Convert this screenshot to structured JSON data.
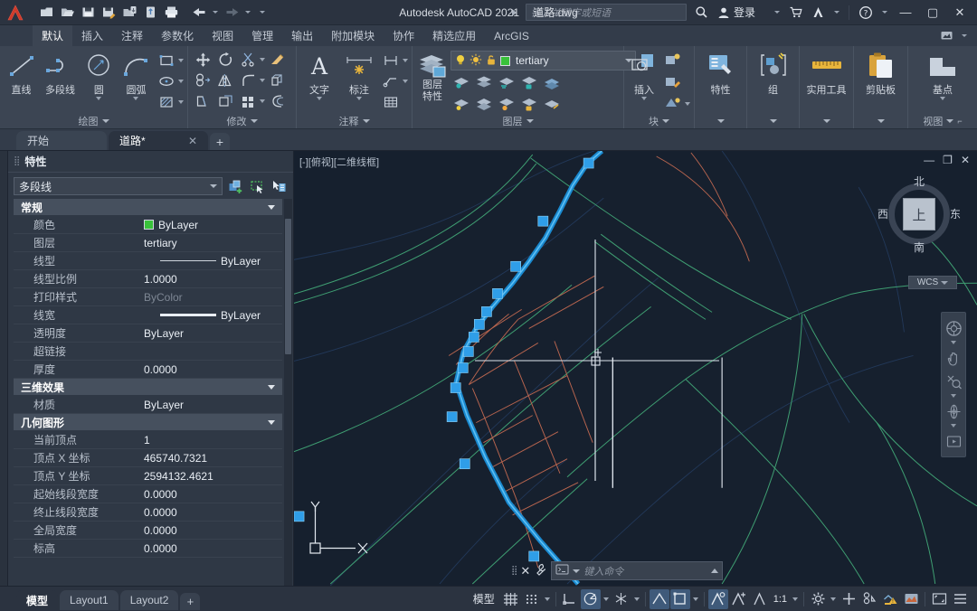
{
  "titlebar": {
    "app_title": "Autodesk AutoCAD 2021",
    "file_name": "道路.dwg",
    "search_placeholder": "键入关键字或短语",
    "signin_label": "登录",
    "qat": [
      {
        "name": "new-file",
        "label": "新建"
      },
      {
        "name": "open-file",
        "label": "打开"
      },
      {
        "name": "save-file",
        "label": "保存"
      },
      {
        "name": "save-as",
        "label": "另存为"
      },
      {
        "name": "open-from-web",
        "label": "从 Web 打开"
      },
      {
        "name": "save-to-web",
        "label": "保存到 Web"
      },
      {
        "name": "plot",
        "label": "打印"
      },
      {
        "name": "undo",
        "label": "放弃"
      },
      {
        "name": "redo",
        "label": "重做"
      }
    ],
    "window_buttons": {
      "minimize": "—",
      "maximize": "▢",
      "close": "✕"
    }
  },
  "ribbon_tabs": [
    {
      "label": "默认",
      "active": true
    },
    {
      "label": "插入",
      "active": false
    },
    {
      "label": "注释",
      "active": false
    },
    {
      "label": "参数化",
      "active": false
    },
    {
      "label": "视图",
      "active": false
    },
    {
      "label": "管理",
      "active": false
    },
    {
      "label": "输出",
      "active": false
    },
    {
      "label": "附加模块",
      "active": false
    },
    {
      "label": "协作",
      "active": false
    },
    {
      "label": "精选应用",
      "active": false
    },
    {
      "label": "ArcGIS",
      "active": false
    }
  ],
  "ribbon_panels": {
    "draw": {
      "title": "绘图",
      "buttons": [
        {
          "label": "直线",
          "icon": "line-icon"
        },
        {
          "label": "多段线",
          "icon": "polyline-icon"
        },
        {
          "label": "圆",
          "icon": "circle-icon"
        },
        {
          "label": "圆弧",
          "icon": "arc-icon"
        }
      ],
      "small": [
        "rectangle-icon",
        "ellipse-icon",
        "hatch-icon"
      ]
    },
    "modify": {
      "title": "修改",
      "small": [
        "move-icon",
        "rotate-icon",
        "trim-icon",
        "erase-icon",
        "copy-icon",
        "mirror-icon",
        "fillet-icon",
        "explode-icon",
        "stretch-icon",
        "scale-icon",
        "array-icon",
        "offset-icon"
      ]
    },
    "annotation": {
      "title": "注释",
      "buttons": [
        {
          "label": "文字",
          "icon": "text-icon"
        },
        {
          "label": "标注",
          "icon": "dimension-icon"
        }
      ],
      "small": [
        "dimension-style-icon",
        "leader-icon",
        "table-icon"
      ]
    },
    "layers": {
      "title": "图层",
      "properties_label_line1": "图层",
      "properties_label_line2": "特性",
      "current_layer": "tertiary",
      "layer_color": "#39c13a",
      "state_icons": [
        "lightbulb-on-icon",
        "sun-icon",
        "unlock-icon"
      ],
      "small": [
        "layer-isolate-icon",
        "layer-freeze-icon",
        "layer-off-icon",
        "layer-lock-icon",
        "layer-merge-icon",
        "layer-unisolate-icon",
        "layer-match-icon",
        "layer-thaw-icon",
        "layer-unlock-icon",
        "layer-change-icon"
      ]
    },
    "block": {
      "title": "块",
      "button": {
        "label": "插入",
        "icon": "insert-block-icon"
      },
      "small": [
        "block-editor-icon",
        "edit-attribute-icon",
        "define-attribute-icon"
      ]
    },
    "properties": {
      "title": "",
      "button": {
        "label": "特性",
        "icon": "properties-icon"
      }
    },
    "group": {
      "title": "",
      "button": {
        "label": "组",
        "icon": "group-icon"
      }
    },
    "utilities": {
      "title": "",
      "button": {
        "label": "实用工具",
        "icon": "measure-icon"
      }
    },
    "clipboard": {
      "title": "",
      "button": {
        "label": "剪贴板",
        "icon": "clipboard-icon"
      }
    },
    "view": {
      "title": "视图",
      "button": {
        "label": "基点",
        "icon": "base-point-icon"
      }
    }
  },
  "file_tabs": [
    {
      "label": "开始",
      "active": false,
      "closable": false
    },
    {
      "label": "道路*",
      "active": true,
      "closable": true
    }
  ],
  "file_tab_add": "+",
  "properties_palette": {
    "title": "特性",
    "selected_object": "多段线",
    "toolbar_icons": [
      "pickadd-toggle-icon",
      "select-objects-icon",
      "quick-select-icon"
    ],
    "groups": [
      {
        "name": "常规",
        "rows": [
          {
            "label": "颜色",
            "value": "ByLayer",
            "kind": "color",
            "color": "#39c13a"
          },
          {
            "label": "图层",
            "value": "tertiary",
            "kind": "text"
          },
          {
            "label": "线型",
            "value": "ByLayer",
            "kind": "linetype"
          },
          {
            "label": "线型比例",
            "value": "1.0000",
            "kind": "text"
          },
          {
            "label": "打印样式",
            "value": "ByColor",
            "kind": "dim"
          },
          {
            "label": "线宽",
            "value": "ByLayer",
            "kind": "lineweight"
          },
          {
            "label": "透明度",
            "value": "ByLayer",
            "kind": "text"
          },
          {
            "label": "超链接",
            "value": "",
            "kind": "text"
          },
          {
            "label": "厚度",
            "value": "0.0000",
            "kind": "text"
          }
        ]
      },
      {
        "name": "三维效果",
        "rows": [
          {
            "label": "材质",
            "value": "ByLayer",
            "kind": "text"
          }
        ]
      },
      {
        "name": "几何图形",
        "rows": [
          {
            "label": "当前顶点",
            "value": "1",
            "kind": "text"
          },
          {
            "label": "顶点 X 坐标",
            "value": "465740.7321",
            "kind": "text"
          },
          {
            "label": "顶点 Y 坐标",
            "value": "2594132.4621",
            "kind": "text"
          },
          {
            "label": "起始线段宽度",
            "value": "0.0000",
            "kind": "text"
          },
          {
            "label": "终止线段宽度",
            "value": "0.0000",
            "kind": "text"
          },
          {
            "label": "全局宽度",
            "value": "0.0000",
            "kind": "text"
          },
          {
            "label": "标高",
            "value": "0.0000",
            "kind": "text"
          }
        ]
      }
    ]
  },
  "canvas": {
    "viewport_label": "[-][俯视][二维线框]",
    "window_buttons": {
      "minimize": "—",
      "restore": "❐",
      "close": "✕"
    },
    "background_color": "#16202e",
    "selected_entity_color": "#1f9ae8",
    "grip_color": "#2f9ee8",
    "viewcube": {
      "north": "北",
      "south": "南",
      "west": "西",
      "east": "东",
      "top": "上",
      "wcs_label": "WCS"
    },
    "navbar_icons": [
      "steering-wheel-icon",
      "pan-icon",
      "zoom-icon",
      "orbit-icon",
      "showmotion-icon"
    ],
    "ucs": {
      "x_label": "X",
      "y_label": "Y"
    },
    "command_line": {
      "placeholder": "键入命令",
      "prompt_icon": "command-prompt-icon"
    }
  },
  "statusbar": {
    "layout_tabs": [
      {
        "label": "模型",
        "active": true
      },
      {
        "label": "Layout1",
        "active": false
      },
      {
        "label": "Layout2",
        "active": false
      }
    ],
    "layout_add": "+",
    "model_label": "模型",
    "scale": "1:1",
    "toggles": [
      {
        "name": "grid-display",
        "on": false
      },
      {
        "name": "snap-mode",
        "on": false
      },
      {
        "name": "ortho-mode",
        "on": false
      },
      {
        "name": "polar-tracking",
        "on": true
      },
      {
        "name": "isodraft",
        "on": false
      },
      {
        "name": "object-snap-tracking",
        "on": true
      },
      {
        "name": "object-snap",
        "on": true
      },
      {
        "name": "lineweight",
        "on": true
      },
      {
        "name": "transparency",
        "on": false
      },
      {
        "name": "selection-cycling",
        "on": false
      }
    ],
    "right_icons": [
      "workspace-gear-icon",
      "hardware-accel-icon",
      "isolate-objects-icon",
      "annotation-monitor-icon",
      "clean-screen-icon",
      "customization-icon"
    ]
  }
}
